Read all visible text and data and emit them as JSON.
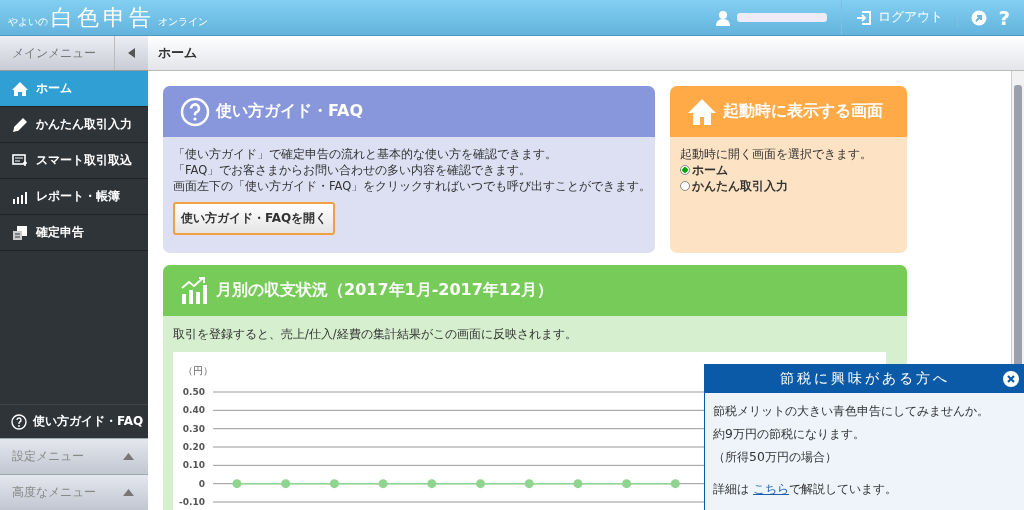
{
  "header": {
    "logo_small": "やよいの",
    "logo_main": "白色申告",
    "logo_suffix": "オンライン",
    "logout": "ログアウト",
    "help": "?"
  },
  "sidebar": {
    "title": "メインメニュー",
    "items": [
      {
        "label": "ホーム",
        "selected": true
      },
      {
        "label": "かんたん取引入力",
        "selected": false
      },
      {
        "label": "スマート取引取込",
        "selected": false
      },
      {
        "label": "レポート・帳簿",
        "selected": false
      },
      {
        "label": "確定申告",
        "selected": false
      }
    ],
    "guide": "使い方ガイド・FAQ",
    "sections": [
      {
        "label": "設定メニュー",
        "expanded": false
      },
      {
        "label": "高度なメニュー",
        "expanded": false
      }
    ]
  },
  "page_title": "ホーム",
  "guide_card": {
    "title": "使い方ガイド・FAQ",
    "lines": [
      "「使い方ガイド」で確定申告の流れと基本的な使い方を確認できます。",
      "「FAQ」でお客さまからお問い合わせの多い内容を確認できます。",
      "画面左下の「使い方ガイド・FAQ」をクリックすればいつでも呼び出すことができます。"
    ],
    "button": "使い方ガイド・FAQを開く"
  },
  "startup_card": {
    "title": "起動時に表示する画面",
    "description": "起動時に開く画面を選択できます。",
    "options": [
      {
        "label": "ホーム",
        "selected": true
      },
      {
        "label": "かんたん取引入力",
        "selected": false
      }
    ]
  },
  "summary_card": {
    "title": "月別の収支状況（2017年1月-2017年12月）",
    "description": "取引を登録すると、売上/仕入/経費の集計結果がこの画面に反映されます。",
    "chart_data": {
      "type": "line",
      "grid": true,
      "ylabel": "（円）",
      "ylim": [
        -0.1,
        0.5
      ],
      "yticks": [
        {
          "value": 0.5,
          "label": "0.50"
        },
        {
          "value": 0.4,
          "label": "0.40"
        },
        {
          "value": 0.3,
          "label": "0.30"
        },
        {
          "value": 0.2,
          "label": "0.20"
        },
        {
          "value": 0.1,
          "label": "0.10"
        },
        {
          "value": 0,
          "label": "0"
        },
        {
          "value": -0.1,
          "label": "-0.10"
        }
      ],
      "series": [
        {
          "color": "#8fd48f",
          "marker": true,
          "values": [
            0,
            0,
            0,
            0,
            0,
            0,
            0,
            0,
            0,
            0
          ]
        }
      ]
    }
  },
  "popup": {
    "title": "節税に興味がある方へ",
    "lines": [
      "節税メリットの大きい青色申告にしてみませんか。",
      "約9万円の節税になります。",
      "（所得50万円の場合）"
    ],
    "detail_before": "詳細は",
    "link": "こちら",
    "detail_after": "で解説しています。"
  }
}
